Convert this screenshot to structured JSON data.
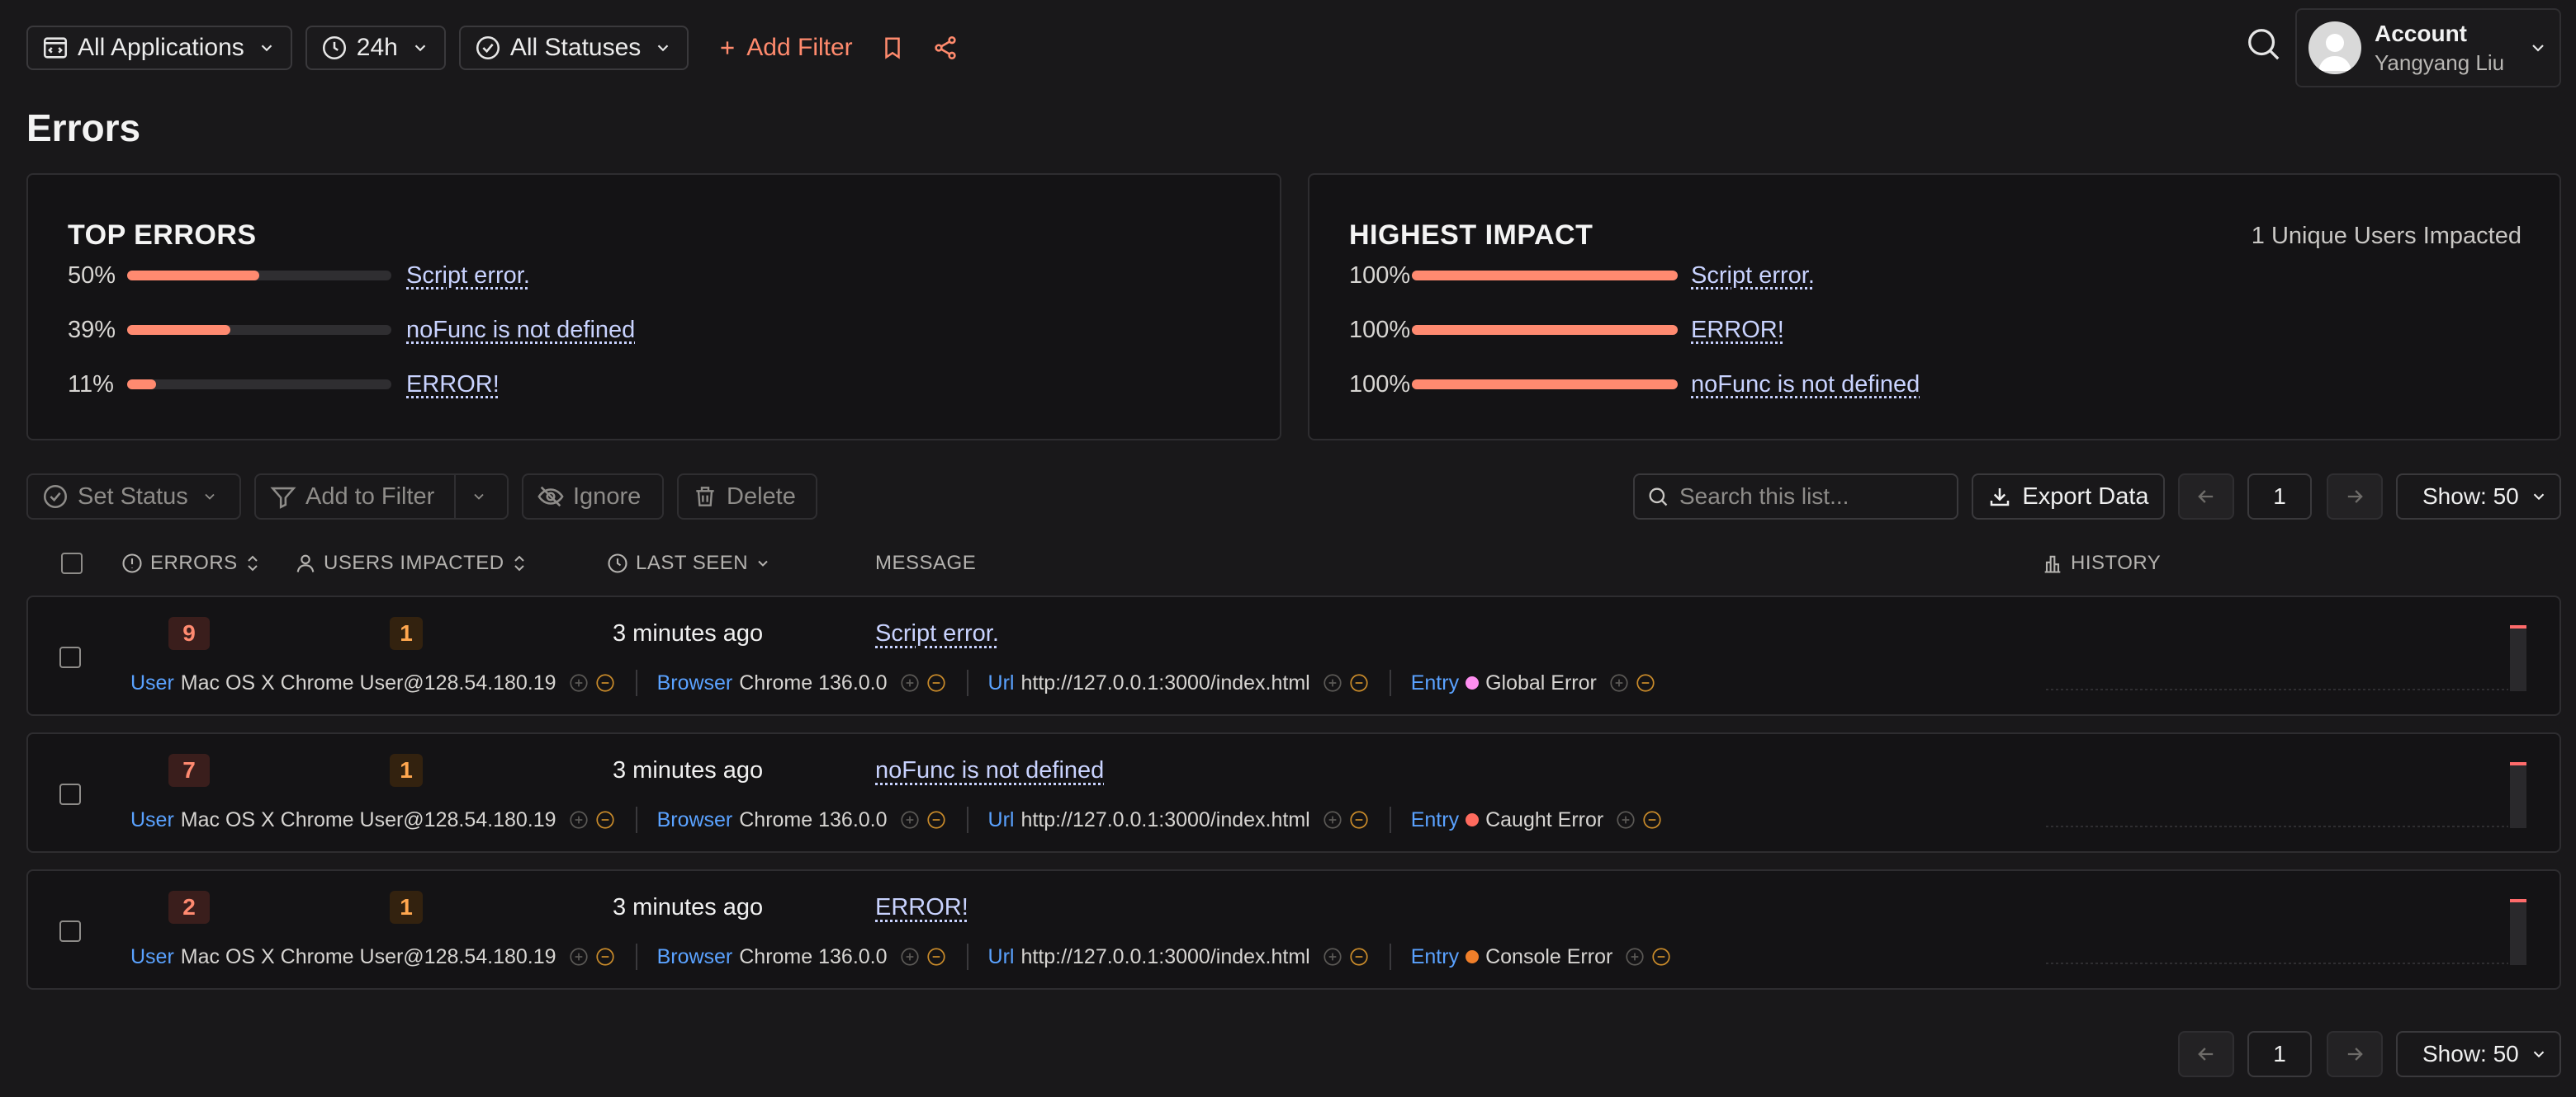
{
  "topbar": {
    "filters": [
      {
        "label": "All Applications",
        "icon": "application-icon"
      },
      {
        "label": "24h",
        "icon": "clock-icon"
      },
      {
        "label": "All Statuses",
        "icon": "check-circle-icon"
      }
    ],
    "add_filter_label": "Add Filter"
  },
  "account": {
    "title": "Account",
    "user": "Yangyang Liu"
  },
  "page_title": "Errors",
  "top_errors": {
    "title": "TOP ERRORS",
    "items": [
      {
        "pct": "50%",
        "value": 0.5,
        "message": "Script error."
      },
      {
        "pct": "39%",
        "value": 0.39,
        "message": "noFunc is not defined"
      },
      {
        "pct": "11%",
        "value": 0.11,
        "message": "ERROR!"
      }
    ]
  },
  "highest_impact": {
    "title": "HIGHEST IMPACT",
    "meta": "1 Unique Users Impacted",
    "items": [
      {
        "pct": "100%",
        "value": 1.0,
        "message": "Script error."
      },
      {
        "pct": "100%",
        "value": 1.0,
        "message": "ERROR!"
      },
      {
        "pct": "100%",
        "value": 1.0,
        "message": "noFunc is not defined"
      }
    ]
  },
  "toolbar": {
    "set_status": "Set Status",
    "add_to_filter": "Add to Filter",
    "ignore": "Ignore",
    "delete": "Delete",
    "search_placeholder": "Search this list...",
    "export": "Export Data",
    "page": "1",
    "show": "Show: 50"
  },
  "columns": {
    "errors": "ERRORS",
    "users": "USERS IMPACTED",
    "last_seen": "LAST SEEN",
    "message": "MESSAGE",
    "history": "HISTORY"
  },
  "rows": [
    {
      "errors": "9",
      "users": "1",
      "last_seen": "3 minutes ago",
      "message": "Script error.",
      "user_key": "User",
      "user_val": "Mac OS X Chrome User@128.54.180.19",
      "browser_key": "Browser",
      "browser_val": "Chrome 136.0.0",
      "url_key": "Url",
      "url_val": "http://127.0.0.1:3000/index.html",
      "entry_key": "Entry",
      "entry_val": "Global Error",
      "entry_color": "#ff8ef0"
    },
    {
      "errors": "7",
      "users": "1",
      "last_seen": "3 minutes ago",
      "message": "noFunc is not defined",
      "user_key": "User",
      "user_val": "Mac OS X Chrome User@128.54.180.19",
      "browser_key": "Browser",
      "browser_val": "Chrome 136.0.0",
      "url_key": "Url",
      "url_val": "http://127.0.0.1:3000/index.html",
      "entry_key": "Entry",
      "entry_val": "Caught Error",
      "entry_color": "#ff6b5e"
    },
    {
      "errors": "2",
      "users": "1",
      "last_seen": "3 minutes ago",
      "message": "ERROR!",
      "user_key": "User",
      "user_val": "Mac OS X Chrome User@128.54.180.19",
      "browser_key": "Browser",
      "browser_val": "Chrome 136.0.0",
      "url_key": "Url",
      "url_val": "http://127.0.0.1:3000/index.html",
      "entry_key": "Entry",
      "entry_val": "Console Error",
      "entry_color": "#f07f2a"
    }
  ],
  "footer": {
    "page": "1",
    "show": "Show: 50"
  },
  "colors": {
    "accent": "#ff8a70",
    "link": "#c9d3ff",
    "tag_key": "#5aa2ff"
  }
}
